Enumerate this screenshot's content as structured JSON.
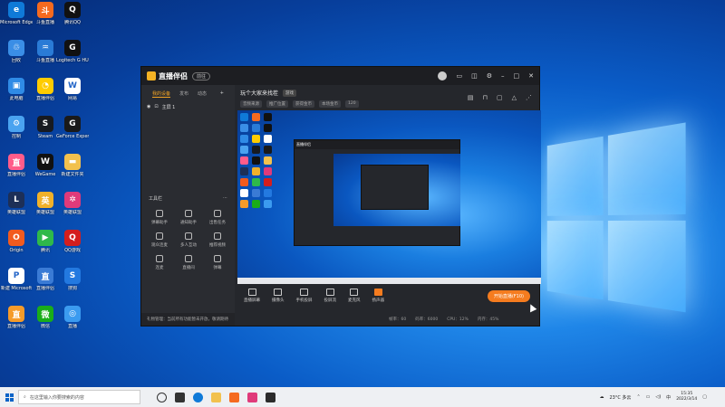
{
  "desktop_icons": [
    {
      "label": "Microsoft Edge",
      "color": "#0f7ad8",
      "glyph": "e"
    },
    {
      "label": "斗鱼直播",
      "color": "#f56a1f",
      "glyph": "斗"
    },
    {
      "label": "腾讯QQ",
      "color": "#111111",
      "glyph": "Q"
    },
    {
      "label": "回收",
      "color": "#3a8ee6",
      "glyph": "♲"
    },
    {
      "label": "斗鱼直播",
      "color": "#2a7bd6",
      "glyph": "♒"
    },
    {
      "label": "Logitech G HUB",
      "color": "#111111",
      "glyph": "G"
    },
    {
      "label": "此电脑",
      "color": "#2f8be6",
      "glyph": "▣"
    },
    {
      "label": "直播伴侣",
      "color": "#ffcc00",
      "glyph": "◔"
    },
    {
      "label": "网易",
      "color": "#ffffff",
      "glyph": "W"
    },
    {
      "label": "控制",
      "color": "#4aa3f0",
      "glyph": "⚙"
    },
    {
      "label": "Steam",
      "color": "#171a21",
      "glyph": "S"
    },
    {
      "label": "GeForce Experience",
      "color": "#1a1a1a",
      "glyph": "G"
    },
    {
      "label": "直播伴侣",
      "color": "#ff5c8a",
      "glyph": "直"
    },
    {
      "label": "WeGame",
      "color": "#111111",
      "glyph": "W"
    },
    {
      "label": "新建文件夹",
      "color": "#f2c14e",
      "glyph": "▬"
    },
    {
      "label": "英雄联盟",
      "color": "#1d2f57",
      "glyph": "L"
    },
    {
      "label": "英雄联盟",
      "color": "#f0b12a",
      "glyph": "英"
    },
    {
      "label": "英雄联盟",
      "color": "#e03a7a",
      "glyph": "✲"
    },
    {
      "label": "Origin",
      "color": "#f25b1f",
      "glyph": "O"
    },
    {
      "label": "腾讯",
      "color": "#2fb94a",
      "glyph": "▶"
    },
    {
      "label": "QQ游戏",
      "color": "#d41e1e",
      "glyph": "Q"
    },
    {
      "label": "新建 Microsoft",
      "color": "#ffffff",
      "glyph": "P"
    },
    {
      "label": "直播伴侣",
      "color": "#3a7bd5",
      "glyph": "直"
    },
    {
      "label": "搜狗",
      "color": "#2379e0",
      "glyph": "S"
    },
    {
      "label": "直播伴侣",
      "color": "#f59b2a",
      "glyph": "直"
    },
    {
      "label": "微信",
      "color": "#1aad19",
      "glyph": "微"
    },
    {
      "label": "直播",
      "color": "#3b9bf0",
      "glyph": "◎"
    }
  ],
  "app": {
    "name": "直播伴侣",
    "badge": "前往",
    "sidebar_tabs": [
      "我的设备",
      "发布",
      "动态"
    ],
    "scene_label": "主屏 1",
    "tools_header": "工具栏",
    "tools": [
      "弹幕助手",
      "通知助手",
      "出售任务",
      "观众连麦",
      "多人互动",
      "推荐视频",
      "连麦",
      "直播间",
      "弹幕"
    ],
    "footer_text": "礼物管理：当前所有功能暂未开放，敬请期待",
    "room_title": "玩个大家来找茬",
    "room_tag": "游戏",
    "room_pills": [
      "音频来源",
      "推广位置",
      "获得金币",
      "本场金币",
      "120"
    ],
    "controls": [
      "直播屏幕",
      "摄像头",
      "手机投屏",
      "投屏流",
      "麦克风",
      "扬声器"
    ],
    "live_button": "开始直播(F10)",
    "status_items": [
      "帧率：60",
      "码率：6000",
      "CPU：12%",
      "内存：45%"
    ]
  },
  "taskbar": {
    "search_placeholder": "在这里输入你要搜索的内容",
    "weather": "23°C 多云",
    "lang": "中",
    "time": "15:35",
    "date": "2022/3/14"
  }
}
